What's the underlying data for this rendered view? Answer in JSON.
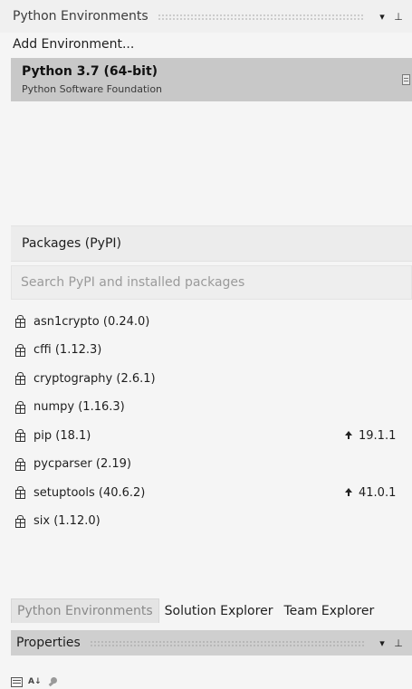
{
  "panel": {
    "title": "Python Environments",
    "dropdown_glyph": "▾",
    "pin_glyph": "⊥"
  },
  "add_environment_label": "Add Environment...",
  "environment": {
    "name": "Python 3.7 (64-bit)",
    "publisher": "Python Software Foundation"
  },
  "packages_section": {
    "title": "Packages (PyPI)",
    "search_placeholder": "Search PyPI and installed packages"
  },
  "packages": [
    {
      "label": "asn1crypto (0.24.0)",
      "upgrade": ""
    },
    {
      "label": "cffi (1.12.3)",
      "upgrade": ""
    },
    {
      "label": "cryptography (2.6.1)",
      "upgrade": ""
    },
    {
      "label": "numpy (1.16.3)",
      "upgrade": ""
    },
    {
      "label": "pip (18.1)",
      "upgrade": "19.1.1"
    },
    {
      "label": "pycparser (2.19)",
      "upgrade": ""
    },
    {
      "label": "setuptools (40.6.2)",
      "upgrade": "41.0.1"
    },
    {
      "label": "six (1.12.0)",
      "upgrade": ""
    }
  ],
  "tabs": [
    {
      "label": "Python Environments",
      "active": true
    },
    {
      "label": "Solution Explorer",
      "active": false
    },
    {
      "label": "Team Explorer",
      "active": false
    }
  ],
  "properties": {
    "title": "Properties",
    "alpha_icon_text": "A↓"
  },
  "icons": {
    "package": "package-icon",
    "upgrade": "arrow-up-icon"
  },
  "colors": {
    "selected_env_bg": "#c8c8c8",
    "properties_header_bg": "#cfcfcf",
    "panel_bg": "#f5f5f5"
  }
}
